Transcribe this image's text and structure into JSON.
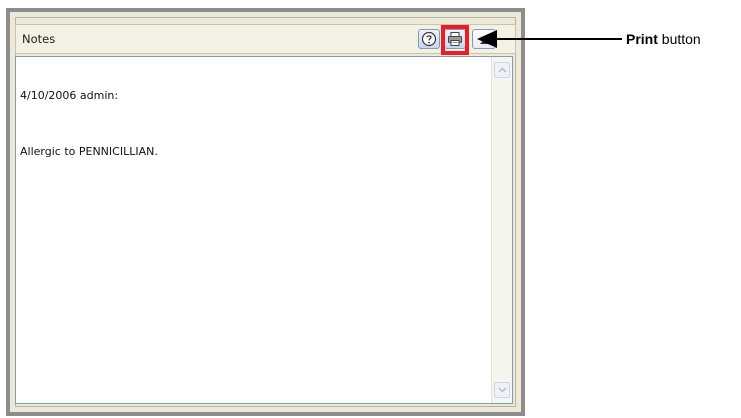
{
  "panel": {
    "title": "Notes",
    "toolbar": {
      "help_icon": "help-icon",
      "print_icon": "printer-icon",
      "expand_icon": "expand-icon"
    },
    "notes": {
      "header_line": "4/10/2006 admin:",
      "body_line": "Allergic to PENNICILLIAN."
    }
  },
  "annotation": {
    "label_bold": "Print",
    "label_rest": " button",
    "highlight_color": "#ee1c24"
  }
}
